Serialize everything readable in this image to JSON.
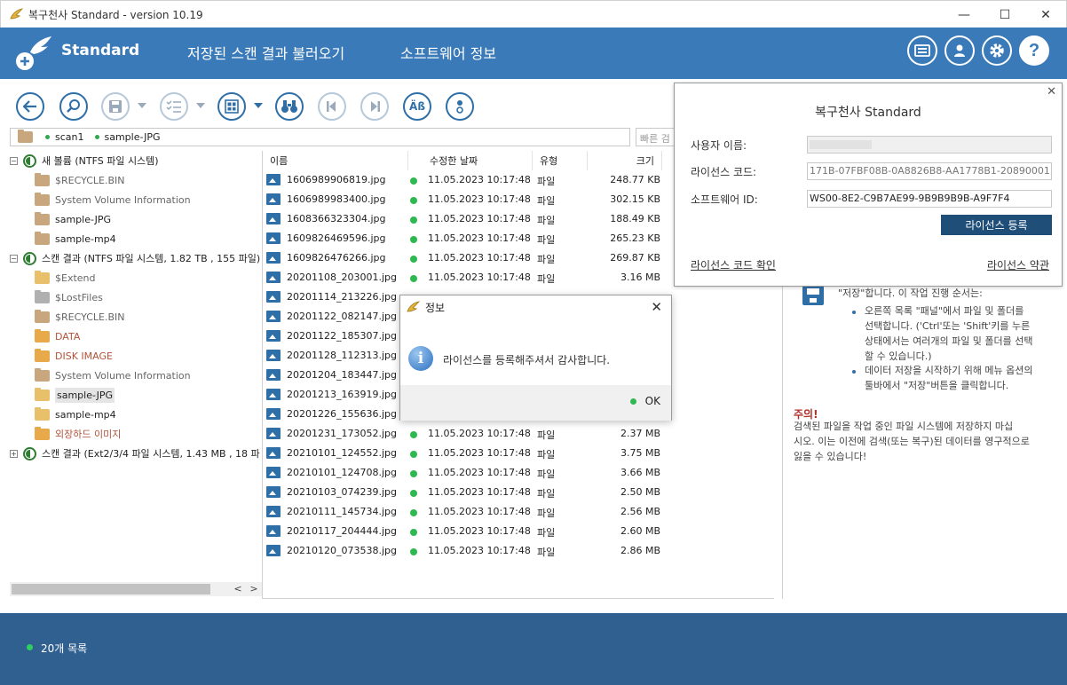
{
  "window": {
    "title": "복구천사 Standard - version 10.19"
  },
  "header": {
    "brand": "Standard",
    "nav": [
      "저장된 스캔 결과 불러오기",
      "소프트웨어 정보"
    ],
    "icons": [
      "news-icon",
      "user-icon",
      "gear-icon",
      "help-icon"
    ]
  },
  "path": {
    "segments": [
      "scan1",
      "sample-JPG"
    ],
    "search_placeholder": "빠른 검"
  },
  "tree": {
    "items": [
      {
        "label": "새 볼륨 (NTFS 파일 시스템)",
        "kind": "volume",
        "toggle": "⊟"
      },
      {
        "label": "$RECYCLE.BIN",
        "kind": "folder-tan",
        "color": "gray"
      },
      {
        "label": "System Volume Information",
        "kind": "folder-tan",
        "color": "gray"
      },
      {
        "label": "sample-JPG",
        "kind": "folder-tan",
        "color": "black"
      },
      {
        "label": "sample-mp4",
        "kind": "folder-tan",
        "color": "black"
      },
      {
        "label": "스캔 결과 (NTFS 파일 시스템, 1.82 TB , 155 파일)",
        "kind": "volume",
        "toggle": "⊟"
      },
      {
        "label": "$Extend",
        "kind": "folder-yel",
        "color": "gray"
      },
      {
        "label": "$LostFiles",
        "kind": "folder-gray",
        "color": "gray"
      },
      {
        "label": "$RECYCLE.BIN",
        "kind": "folder-tan",
        "color": "gray"
      },
      {
        "label": "DATA",
        "kind": "folder-orange",
        "color": "red"
      },
      {
        "label": "DISK IMAGE",
        "kind": "folder-orange",
        "color": "red"
      },
      {
        "label": "System Volume Information",
        "kind": "folder-tan",
        "color": "gray"
      },
      {
        "label": "sample-JPG",
        "kind": "folder-yel",
        "color": "black",
        "selected": true
      },
      {
        "label": "sample-mp4",
        "kind": "folder-yel",
        "color": "black"
      },
      {
        "label": "외장하드 이미지",
        "kind": "folder-orange",
        "color": "red"
      },
      {
        "label": "스캔 결과 (Ext2/3/4 파일 시스템, 1.43 MB , 18 파",
        "kind": "volume",
        "toggle": "⊞"
      }
    ]
  },
  "files": {
    "columns": [
      "이름",
      "수정한 날짜",
      "유형",
      "크기"
    ],
    "rows": [
      {
        "name": "1606989906819.jpg",
        "date": "11.05.2023 10:17:48",
        "type": "파일",
        "size": "248.77 KB"
      },
      {
        "name": "1606989983400.jpg",
        "date": "11.05.2023 10:17:48",
        "type": "파일",
        "size": "302.15 KB"
      },
      {
        "name": "1608366323304.jpg",
        "date": "11.05.2023 10:17:48",
        "type": "파일",
        "size": "188.49 KB"
      },
      {
        "name": "1609826469596.jpg",
        "date": "11.05.2023 10:17:48",
        "type": "파일",
        "size": "265.23 KB"
      },
      {
        "name": "1609826476266.jpg",
        "date": "11.05.2023 10:17:48",
        "type": "파일",
        "size": "269.87 KB"
      },
      {
        "name": "20201108_203001.jpg",
        "date": "11.05.2023 10:17:48",
        "type": "파일",
        "size": "3.16 MB"
      },
      {
        "name": "20201114_213226.jpg",
        "date": "",
        "type": "",
        "size": ""
      },
      {
        "name": "20201122_082147.jpg",
        "date": "",
        "type": "",
        "size": ""
      },
      {
        "name": "20201122_185307.jpg",
        "date": "",
        "type": "",
        "size": ""
      },
      {
        "name": "20201128_112313.jpg",
        "date": "",
        "type": "",
        "size": ""
      },
      {
        "name": "20201204_183447.jpg",
        "date": "",
        "type": "",
        "size": ""
      },
      {
        "name": "20201213_163919.jpg",
        "date": "",
        "type": "",
        "size": ""
      },
      {
        "name": "20201226_155636.jpg",
        "date": "",
        "type": "",
        "size": ""
      },
      {
        "name": "20201231_173052.jpg",
        "date": "11.05.2023 10:17:48",
        "type": "파일",
        "size": "2.37 MB"
      },
      {
        "name": "20210101_124552.jpg",
        "date": "11.05.2023 10:17:48",
        "type": "파일",
        "size": "3.75 MB"
      },
      {
        "name": "20210101_124708.jpg",
        "date": "11.05.2023 10:17:48",
        "type": "파일",
        "size": "3.66 MB"
      },
      {
        "name": "20210103_074239.jpg",
        "date": "11.05.2023 10:17:48",
        "type": "파일",
        "size": "2.50 MB"
      },
      {
        "name": "20210111_145734.jpg",
        "date": "11.05.2023 10:17:48",
        "type": "파일",
        "size": "2.56 MB"
      },
      {
        "name": "20210117_204444.jpg",
        "date": "11.05.2023 10:17:48",
        "type": "파일",
        "size": "2.60 MB"
      },
      {
        "name": "20210120_073538.jpg",
        "date": "11.05.2023 10:17:48",
        "type": "파일",
        "size": "2.86 MB"
      }
    ]
  },
  "info": {
    "line0": "\"저장\"합니다. 이 작업 진행 순서는:",
    "bullet1": [
      "오른쪽 목록 \"패널\"에서 파일 및 폴더를",
      "선택합니다. ('Ctrl'또는 'Shift'키를 누른",
      "상태에서는 여러개의 파일 및 폴더를 선택",
      "할 수 있습니다.)"
    ],
    "bullet2": [
      "데이터 저장을 시작하기 위해 메뉴 옵션의",
      "툴바에서 \"저장\"버튼을 클릭합니다."
    ],
    "warn_title": "주의!",
    "warn_text": [
      "검색된 파일을 작업 중인 파일 시스템에 저장하지 마십",
      "시오. 이는 이전에 검색(또는 복구)된 데이터를 영구적으로",
      "잃을 수 있습니다!"
    ]
  },
  "license": {
    "title": "복구천사 Standard",
    "user_label": "사용자 이름:",
    "user_value": "",
    "code_label": "라이선스 코드:",
    "code_value": "171B-07FBF08B-0A8826B8-AA1778B1-20890001",
    "id_label": "소프트웨어 ID:",
    "id_value": "WS00-8E2-C9B7AE99-9B9B9B9B-A9F7F4",
    "register_button": "라이선스 등록",
    "check_link": "라이선스 코드 확인",
    "terms_link": "라이선스 약관"
  },
  "dialog": {
    "title": "정보",
    "message": "라이선스를 등록해주셔서 감사합니다.",
    "ok": "OK"
  },
  "status": {
    "text": "20개 목록"
  }
}
